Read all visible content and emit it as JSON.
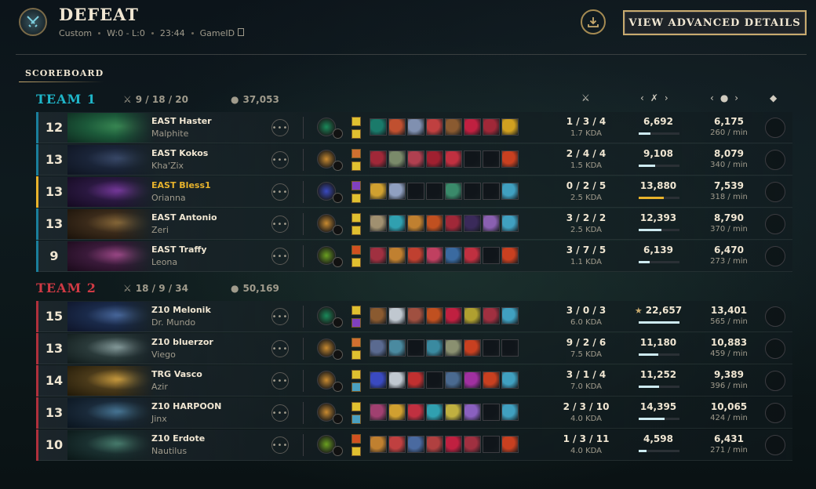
{
  "header": {
    "result": "DEFEAT",
    "mode": "Custom",
    "record": "W:0 - L:0",
    "duration": "23:44",
    "game_id_label": "GameID",
    "advanced_button": "VIEW ADVANCED DETAILS"
  },
  "tabs": {
    "scoreboard": "SCOREBOARD"
  },
  "colors": {
    "team1": "#1fb6c9",
    "team2": "#d03a44",
    "accent_gold": "#c8aa6e",
    "highlight": "#e8b32c"
  },
  "teams": [
    {
      "name": "TEAM 1",
      "kda": "9 / 18 / 20",
      "gold": "37,053",
      "players": [
        {
          "level": "12",
          "name": "EAST Haster",
          "champion": "Malphite",
          "kda": "1 / 3 / 4",
          "kda_ratio": "1.7 KDA",
          "damage": "6,692",
          "damage_fraction": 0.29,
          "gold": "6,175",
          "gpm": "260 / min",
          "self": false,
          "mvp": false,
          "portrait": [
            "#1c5a3a",
            "#3a8a54",
            "#0e2a20"
          ],
          "rune": "#1a8a5a",
          "spells": [
            "#e0c030",
            "#e0c030"
          ],
          "items": [
            "#1a7a6a",
            "#c05030",
            "#8090b0",
            "#c04040",
            "#8a5a30",
            "#c02040",
            "#a02838",
            "#d0a020"
          ]
        },
        {
          "level": "13",
          "name": "EAST Kokos",
          "champion": "Kha'Zix",
          "kda": "2 / 4 / 4",
          "kda_ratio": "1.5 KDA",
          "damage": "9,108",
          "damage_fraction": 0.4,
          "gold": "8,079",
          "gpm": "340 / min",
          "self": false,
          "mvp": false,
          "portrait": [
            "#1a2438",
            "#3a4a6a",
            "#0e1420"
          ],
          "rune": "#c88a30",
          "spells": [
            "#d07030",
            "#e0c030"
          ],
          "items": [
            "#a02838",
            "#7a8a6a",
            "#b04050",
            "#a02030",
            "#c03040",
            "#10151a",
            "#10151a",
            "#c84020"
          ]
        },
        {
          "level": "13",
          "name": "EAST Bless1",
          "champion": "Orianna",
          "kda": "0 / 2 / 5",
          "kda_ratio": "2.5 KDA",
          "damage": "13,880",
          "damage_fraction": 0.61,
          "gold": "7,539",
          "gpm": "318 / min",
          "self": true,
          "mvp": false,
          "portrait": [
            "#2a1840",
            "#7a3aa0",
            "#140a20"
          ],
          "rune": "#3a4ac0",
          "spells": [
            "#8040c0",
            "#e0c030"
          ],
          "items": [
            "#d0a030",
            "#90a0c0",
            "#10151a",
            "#10151a",
            "#3a8a6a",
            "#10151a",
            "#10151a",
            "#40a0c0"
          ]
        },
        {
          "level": "13",
          "name": "EAST Antonio",
          "champion": "Zeri",
          "kda": "3 / 2 / 2",
          "kda_ratio": "2.5 KDA",
          "damage": "12,393",
          "damage_fraction": 0.55,
          "gold": "8,790",
          "gpm": "370 / min",
          "self": false,
          "mvp": false,
          "portrait": [
            "#3a2a1a",
            "#8a6a3a",
            "#1a120a"
          ],
          "rune": "#c88a30",
          "spells": [
            "#e0c030",
            "#e0c030"
          ],
          "items": [
            "#a09070",
            "#30a0b0",
            "#c08030",
            "#c05020",
            "#a02838",
            "#3a2a5a",
            "#8a60b0",
            "#40a0c0"
          ]
        },
        {
          "level": "9",
          "name": "EAST Traffy",
          "champion": "Leona",
          "kda": "3 / 7 / 5",
          "kda_ratio": "1.1 KDA",
          "damage": "6,139",
          "damage_fraction": 0.27,
          "gold": "6,470",
          "gpm": "273 / min",
          "self": false,
          "mvp": false,
          "portrait": [
            "#3a1a3a",
            "#a04a8a",
            "#1a0a1a"
          ],
          "rune": "#6aa020",
          "spells": [
            "#d05020",
            "#e0c030"
          ],
          "items": [
            "#a03040",
            "#c08030",
            "#c04030",
            "#c04060",
            "#3a6aa0",
            "#c03040",
            "#10151a",
            "#c84020"
          ]
        }
      ]
    },
    {
      "name": "TEAM 2",
      "kda": "18 / 9 / 34",
      "gold": "50,169",
      "players": [
        {
          "level": "15",
          "name": "Z10 Melonik",
          "champion": "Dr. Mundo",
          "kda": "3 / 0 / 3",
          "kda_ratio": "6.0 KDA",
          "damage": "22,657",
          "damage_fraction": 1.0,
          "gold": "13,401",
          "gpm": "565 / min",
          "self": false,
          "mvp": true,
          "portrait": [
            "#1a2a4a",
            "#4a6aa0",
            "#0e1428"
          ],
          "rune": "#1a8a5a",
          "spells": [
            "#e0c030",
            "#8040c0"
          ],
          "items": [
            "#8a5a30",
            "#c0c8d0",
            "#a05040",
            "#c05020",
            "#c02040",
            "#b0a030",
            "#a03040",
            "#40a0c0"
          ]
        },
        {
          "level": "13",
          "name": "Z10 bluerzor",
          "champion": "Viego",
          "kda": "9 / 2 / 6",
          "kda_ratio": "7.5 KDA",
          "damage": "11,180",
          "damage_fraction": 0.49,
          "gold": "10,883",
          "gpm": "459 / min",
          "self": false,
          "mvp": false,
          "portrait": [
            "#2a3a3a",
            "#8aa0a0",
            "#101a1a"
          ],
          "rune": "#c88a30",
          "spells": [
            "#d07030",
            "#e0c030"
          ],
          "items": [
            "#5a6a90",
            "#4a8aa0",
            "#10151a",
            "#3a8aa0",
            "#8a9070",
            "#c84020",
            "#10151a",
            "#10151a"
          ]
        },
        {
          "level": "14",
          "name": "TRG Vasco",
          "champion": "Azir",
          "kda": "3 / 1 / 4",
          "kda_ratio": "7.0 KDA",
          "damage": "11,252",
          "damage_fraction": 0.5,
          "gold": "9,389",
          "gpm": "396 / min",
          "self": false,
          "mvp": false,
          "portrait": [
            "#4a3a1a",
            "#d0a040",
            "#201808"
          ],
          "rune": "#c88a30",
          "spells": [
            "#e0c030",
            "#4aa0c0"
          ],
          "items": [
            "#3a4ac0",
            "#c0c8d0",
            "#c03030",
            "#10151a",
            "#4a6a90",
            "#a030a0",
            "#c84020",
            "#40a0c0"
          ]
        },
        {
          "level": "13",
          "name": "Z10 HARPOON",
          "champion": "Jinx",
          "kda": "2 / 3 / 10",
          "kda_ratio": "4.0 KDA",
          "damage": "14,395",
          "damage_fraction": 0.64,
          "gold": "10,065",
          "gpm": "424 / min",
          "self": false,
          "mvp": false,
          "portrait": [
            "#1a2a3a",
            "#4a7a9a",
            "#0a141e"
          ],
          "rune": "#c88a30",
          "spells": [
            "#e0c030",
            "#4aa0c0"
          ],
          "items": [
            "#a04070",
            "#d0a030",
            "#c03040",
            "#30a0b0",
            "#c0b040",
            "#8a60c0",
            "#10151a",
            "#40a0c0"
          ]
        },
        {
          "level": "10",
          "name": "Z10 Erdote",
          "champion": "Nautilus",
          "kda": "1 / 3 / 11",
          "kda_ratio": "4.0 KDA",
          "damage": "4,598",
          "damage_fraction": 0.2,
          "gold": "6,431",
          "gpm": "271 / min",
          "self": false,
          "mvp": false,
          "portrait": [
            "#1a3030",
            "#4a8070",
            "#0a1616"
          ],
          "rune": "#6aa020",
          "spells": [
            "#d05020",
            "#e0c030"
          ],
          "items": [
            "#c08030",
            "#c04040",
            "#4a6aa0",
            "#b04040",
            "#c02040",
            "#a03040",
            "#10151a",
            "#c84020"
          ]
        }
      ]
    }
  ]
}
